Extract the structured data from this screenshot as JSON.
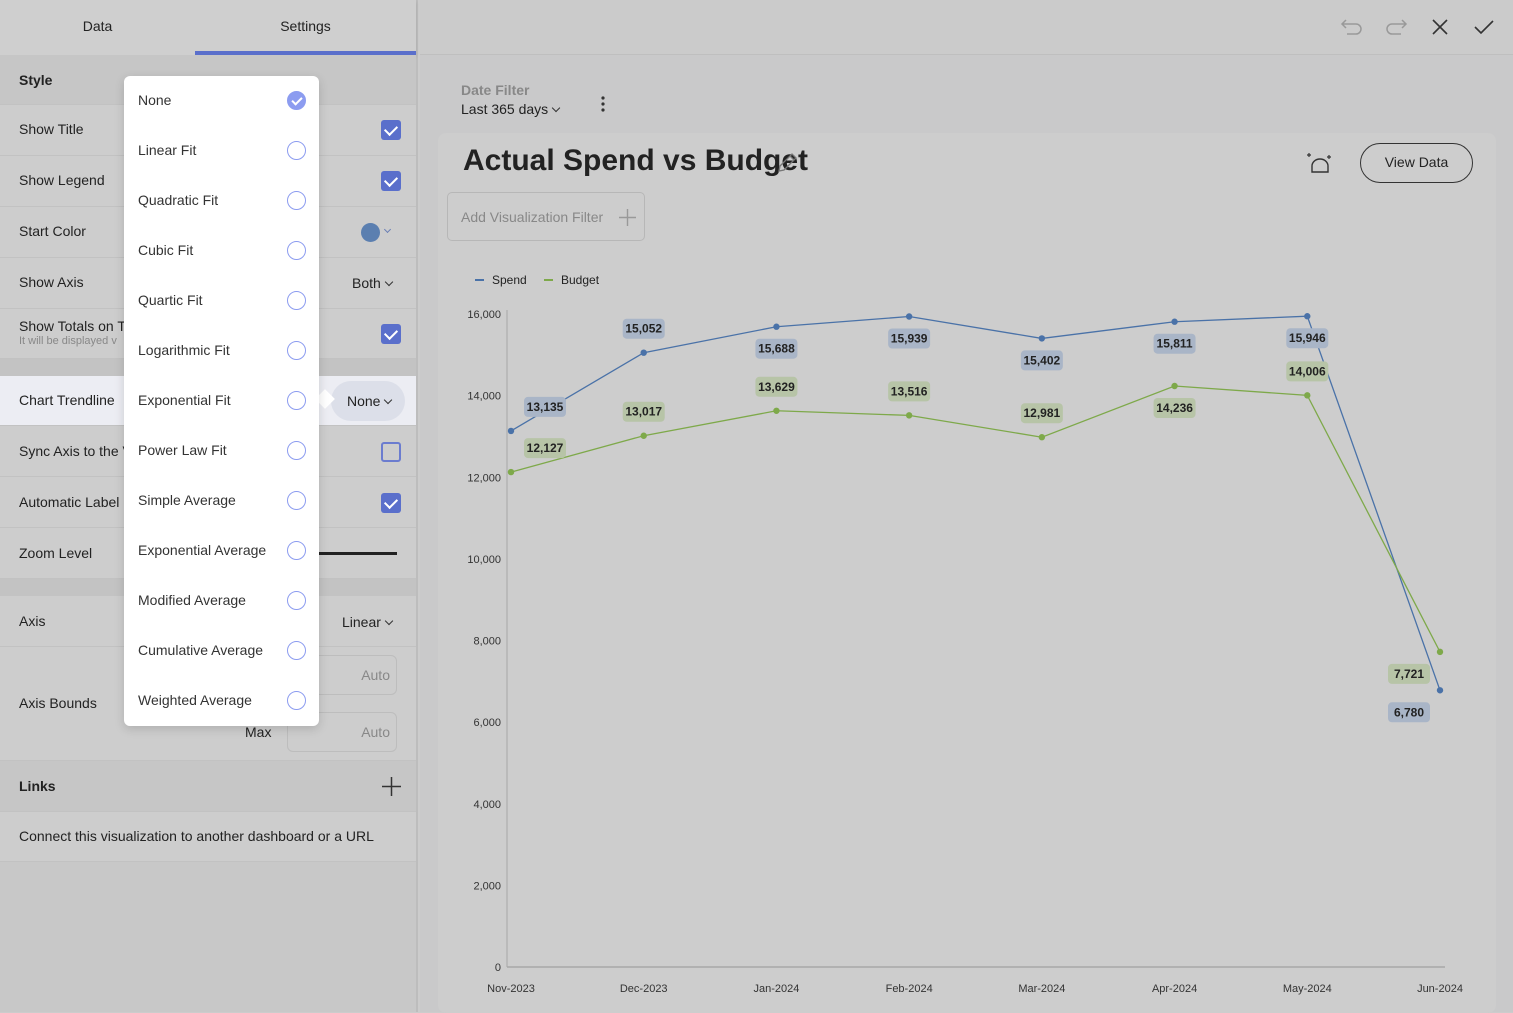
{
  "tabs": [
    {
      "label": "Data",
      "active": false
    },
    {
      "label": "Settings",
      "active": true
    }
  ],
  "settings": {
    "style_header": "Style",
    "show_title": {
      "label": "Show Title",
      "checked": true
    },
    "show_legend": {
      "label": "Show Legend",
      "checked": true
    },
    "start_color": {
      "label": "Start Color",
      "color": "#5b7fb0"
    },
    "show_axis": {
      "label": "Show Axis",
      "value": "Both"
    },
    "show_totals": {
      "label": "Show Totals on T",
      "sublabel": "It will be displayed v",
      "checked": true
    },
    "chart_trendline": {
      "label": "Chart Trendline",
      "value": "None"
    },
    "sync_axis": {
      "label": "Sync Axis to the V",
      "checked": false
    },
    "automatic_label": {
      "label": "Automatic Label",
      "checked": true
    },
    "zoom_level": {
      "label": "Zoom Level"
    },
    "axis": {
      "label": "Axis",
      "value": "Linear"
    },
    "axis_bounds": {
      "label": "Axis Bounds",
      "min_placeholder": "Auto",
      "max_label": "Max",
      "max_placeholder": "Auto"
    },
    "links_header": "Links",
    "links_text": "Connect this visualization to another dashboard or a URL"
  },
  "trendline_options": [
    {
      "label": "None",
      "selected": true
    },
    {
      "label": "Linear Fit",
      "selected": false
    },
    {
      "label": "Quadratic Fit",
      "selected": false
    },
    {
      "label": "Cubic Fit",
      "selected": false
    },
    {
      "label": "Quartic Fit",
      "selected": false
    },
    {
      "label": "Logarithmic Fit",
      "selected": false
    },
    {
      "label": "Exponential Fit",
      "selected": false
    },
    {
      "label": "Power Law Fit",
      "selected": false
    },
    {
      "label": "Simple Average",
      "selected": false
    },
    {
      "label": "Exponential Average",
      "selected": false
    },
    {
      "label": "Modified Average",
      "selected": false
    },
    {
      "label": "Cumulative Average",
      "selected": false
    },
    {
      "label": "Weighted Average",
      "selected": false
    }
  ],
  "toolbar": {
    "icons": [
      "undo-icon",
      "redo-icon",
      "close-icon",
      "check-icon"
    ]
  },
  "date_filter": {
    "label": "Date Filter",
    "value": "Last 365 days"
  },
  "visualization": {
    "title": "Actual Spend vs Budget",
    "view_data_label": "View Data",
    "add_filter_label": "Add Visualization Filter"
  },
  "colors": {
    "spend": "#4a72a8",
    "budget": "#7ea94a",
    "accent": "#5a6fcb",
    "spend_label_bg": "#a9b5c7",
    "budget_label_bg": "#b7c4a7"
  },
  "chart_data": {
    "type": "line",
    "title": "Actual Spend vs Budget",
    "xlabel": "",
    "ylabel": "",
    "categories": [
      "Nov-2023",
      "Dec-2023",
      "Jan-2024",
      "Feb-2024",
      "Mar-2024",
      "Apr-2024",
      "May-2024",
      "Jun-2024"
    ],
    "series": [
      {
        "name": "Spend",
        "values": [
          13135,
          15052,
          15688,
          15939,
          15402,
          15811,
          15946,
          6780
        ],
        "labels": [
          "13,135",
          "15,052",
          "15,688",
          "15,939",
          "15,402",
          "15,811",
          "15,946",
          "6,780"
        ]
      },
      {
        "name": "Budget",
        "values": [
          12127,
          13017,
          13629,
          13516,
          12981,
          14236,
          14006,
          7721
        ],
        "labels": [
          "12,127",
          "13,017",
          "13,629",
          "13,516",
          "12,981",
          "14,236",
          "14,006",
          "7,721"
        ]
      }
    ],
    "ylim": [
      0,
      16000
    ],
    "yticks": [
      0,
      2000,
      4000,
      6000,
      8000,
      10000,
      12000,
      14000,
      16000
    ],
    "ytick_labels": [
      "0",
      "2,000",
      "4,000",
      "6,000",
      "8,000",
      "10,000",
      "12,000",
      "14,000",
      "16,000"
    ],
    "legend": "top-left",
    "grid": false
  }
}
